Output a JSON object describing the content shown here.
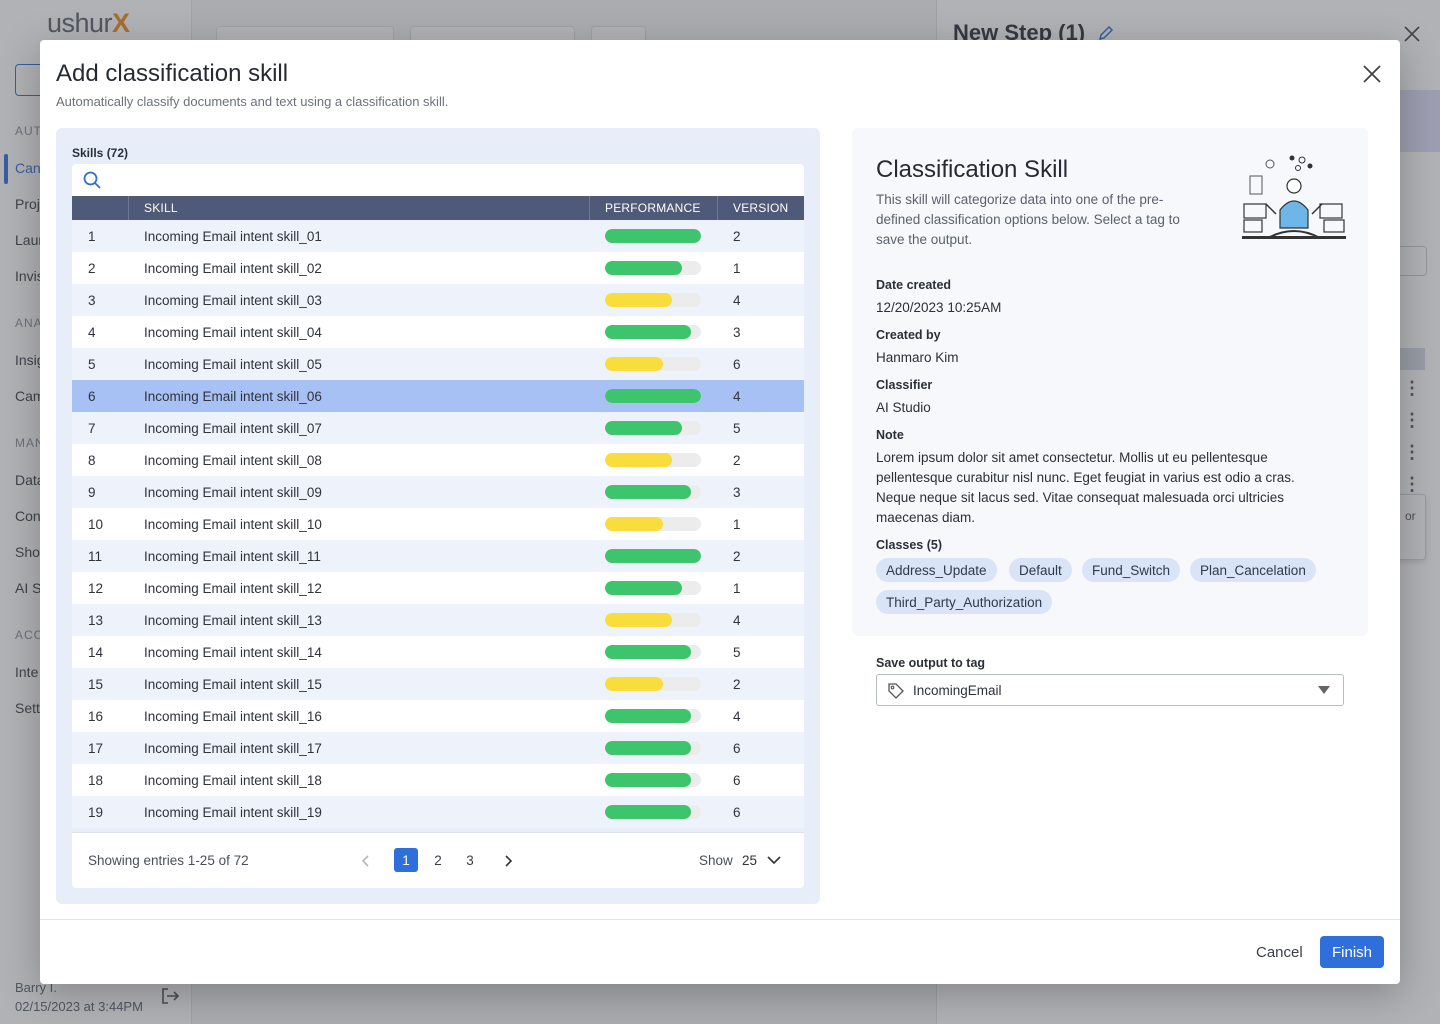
{
  "background": {
    "logo_text": "ushur",
    "logo_mark": "X",
    "nav": [
      {
        "label": "AUT",
        "section": true
      },
      {
        "label": "Can",
        "active": true
      },
      {
        "label": "Proj"
      },
      {
        "label": "Laur"
      },
      {
        "label": "Invis"
      },
      {
        "label": "ANA",
        "section": true
      },
      {
        "label": "Insig"
      },
      {
        "label": "Cam"
      },
      {
        "label": "MAN",
        "section": true
      },
      {
        "label": "Data"
      },
      {
        "label": "Con"
      },
      {
        "label": "Sho"
      },
      {
        "label": "AI S"
      },
      {
        "label": "ACC",
        "section": true
      },
      {
        "label": "Inte"
      },
      {
        "label": "Sett"
      }
    ],
    "user_name": "Barry I.",
    "user_time": "02/15/2023 at 3:44PM",
    "panel_title": "New Step (1)",
    "panel_partial_text": "or"
  },
  "modal": {
    "title": "Add classification skill",
    "subtitle": "Automatically classify documents and text using a classification skill.",
    "skills_label": "Skills (72)",
    "search": {
      "placeholder": "",
      "value": ""
    },
    "columns": [
      "",
      "SKILL",
      "PERFORMANCE",
      "VERSION"
    ],
    "rows": [
      {
        "num": "1",
        "skill": "Incoming Email intent skill_01",
        "performance": 1.0,
        "color": "green",
        "version": "2"
      },
      {
        "num": "2",
        "skill": "Incoming Email intent skill_02",
        "performance": 0.8,
        "color": "green",
        "version": "1"
      },
      {
        "num": "3",
        "skill": "Incoming Email intent skill_03",
        "performance": 0.7,
        "color": "yellow",
        "version": "4"
      },
      {
        "num": "4",
        "skill": "Incoming Email intent skill_04",
        "performance": 0.9,
        "color": "green",
        "version": "3"
      },
      {
        "num": "5",
        "skill": "Incoming Email intent skill_05",
        "performance": 0.6,
        "color": "yellow",
        "version": "6"
      },
      {
        "num": "6",
        "skill": "Incoming Email intent skill_06",
        "performance": 1.0,
        "color": "green",
        "version": "4",
        "selected": true
      },
      {
        "num": "7",
        "skill": "Incoming Email intent skill_07",
        "performance": 0.8,
        "color": "green",
        "version": "5"
      },
      {
        "num": "8",
        "skill": "Incoming Email intent skill_08",
        "performance": 0.7,
        "color": "yellow",
        "version": "2"
      },
      {
        "num": "9",
        "skill": "Incoming Email intent skill_09",
        "performance": 0.9,
        "color": "green",
        "version": "3"
      },
      {
        "num": "10",
        "skill": "Incoming Email intent skill_10",
        "performance": 0.6,
        "color": "yellow",
        "version": "1"
      },
      {
        "num": "11",
        "skill": "Incoming Email intent skill_11",
        "performance": 1.0,
        "color": "green",
        "version": "2"
      },
      {
        "num": "12",
        "skill": "Incoming Email intent skill_12",
        "performance": 0.8,
        "color": "green",
        "version": "1"
      },
      {
        "num": "13",
        "skill": "Incoming Email intent skill_13",
        "performance": 0.7,
        "color": "yellow",
        "version": "4"
      },
      {
        "num": "14",
        "skill": "Incoming Email intent skill_14",
        "performance": 0.9,
        "color": "green",
        "version": "5"
      },
      {
        "num": "15",
        "skill": "Incoming Email intent skill_15",
        "performance": 0.6,
        "color": "yellow",
        "version": "2"
      },
      {
        "num": "16",
        "skill": "Incoming Email intent skill_16",
        "performance": 0.9,
        "color": "green",
        "version": "4"
      },
      {
        "num": "17",
        "skill": "Incoming Email intent skill_17",
        "performance": 0.9,
        "color": "green",
        "version": "6"
      },
      {
        "num": "18",
        "skill": "Incoming Email intent skill_18",
        "performance": 0.9,
        "color": "green",
        "version": "6"
      },
      {
        "num": "19",
        "skill": "Incoming Email intent skill_19",
        "performance": 0.9,
        "color": "green",
        "version": "6"
      }
    ],
    "colors": {
      "green": "#3ec46d",
      "yellow": "#f9dd3c",
      "accent": "#2f6fdb",
      "selected_row": "#a8c1f5"
    },
    "footer": {
      "entries_text": "Showing entries 1-25 of 72",
      "pages": [
        "1",
        "2",
        "3"
      ],
      "current_page": "1",
      "show_label": "Show",
      "show_value": "25"
    },
    "detail": {
      "title": "Classification Skill",
      "description": "This skill will categorize data into one of the pre-defined classification options below. Select a tag to save the output.",
      "date_created_label": "Date created",
      "date_created": "12/20/2023 10:25AM",
      "created_by_label": "Created by",
      "created_by": "Hanmaro Kim",
      "classifier_label": "Classifier",
      "classifier": "AI Studio",
      "note_label": "Note",
      "note": "Lorem ipsum dolor sit amet consectetur. Mollis ut eu pellentesque pellentesque curabitur nisl nunc. Eget feugiat in varius est odio a cras. Neque neque sit lacus sed. Vitae consequat malesuada orci ultricies maecenas diam.",
      "classes_label": "Classes (5)",
      "classes": [
        "Address_Update",
        "Default",
        "Fund_Switch",
        "Plan_Cancelation",
        "Third_Party_Authorization"
      ]
    },
    "save_tag": {
      "label": "Save output to tag",
      "value": "IncomingEmail",
      "icon": "tag-icon"
    },
    "buttons": {
      "cancel": "Cancel",
      "finish": "Finish"
    }
  }
}
